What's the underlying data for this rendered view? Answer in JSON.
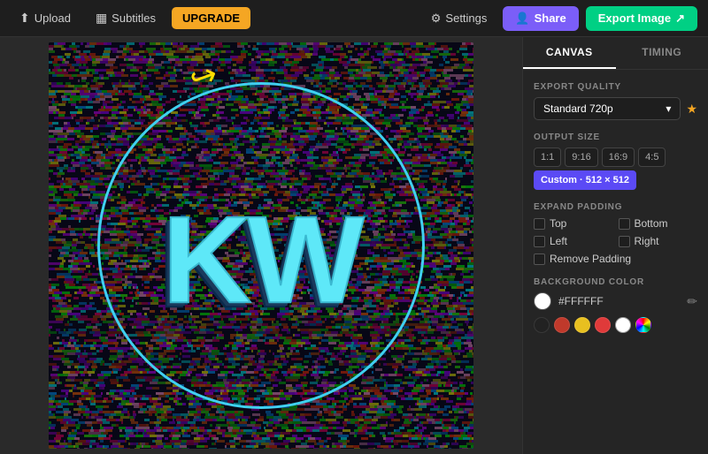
{
  "topbar": {
    "upload_label": "Upload",
    "subtitles_label": "Subtitles",
    "upgrade_label": "UPGRADE",
    "settings_label": "Settings",
    "share_label": "Share",
    "export_label": "Export Image"
  },
  "panel": {
    "tab_canvas": "CANVAS",
    "tab_timing": "TIMING",
    "export_quality_label": "EXPORT QUALITY",
    "quality_value": "Standard 720p",
    "output_size_label": "OUTPUT SIZE",
    "sizes": [
      "1:1",
      "9:16",
      "16:9",
      "4:5"
    ],
    "active_size": "Custom · 512 × 512",
    "expand_padding_label": "EXPAND PADDING",
    "top_label": "Top",
    "bottom_label": "Bottom",
    "left_label": "Left",
    "right_label": "Right",
    "remove_padding_label": "Remove Padding",
    "bg_color_label": "BACKGROUND COLOR",
    "hex_value": "#FFFFFF",
    "swatches": [
      "#222222",
      "#e03a3a",
      "#e8c020",
      "#e03a3a",
      "#ffffff",
      "#aaaaaa"
    ]
  },
  "canvas": {
    "kw_text": "KW"
  }
}
